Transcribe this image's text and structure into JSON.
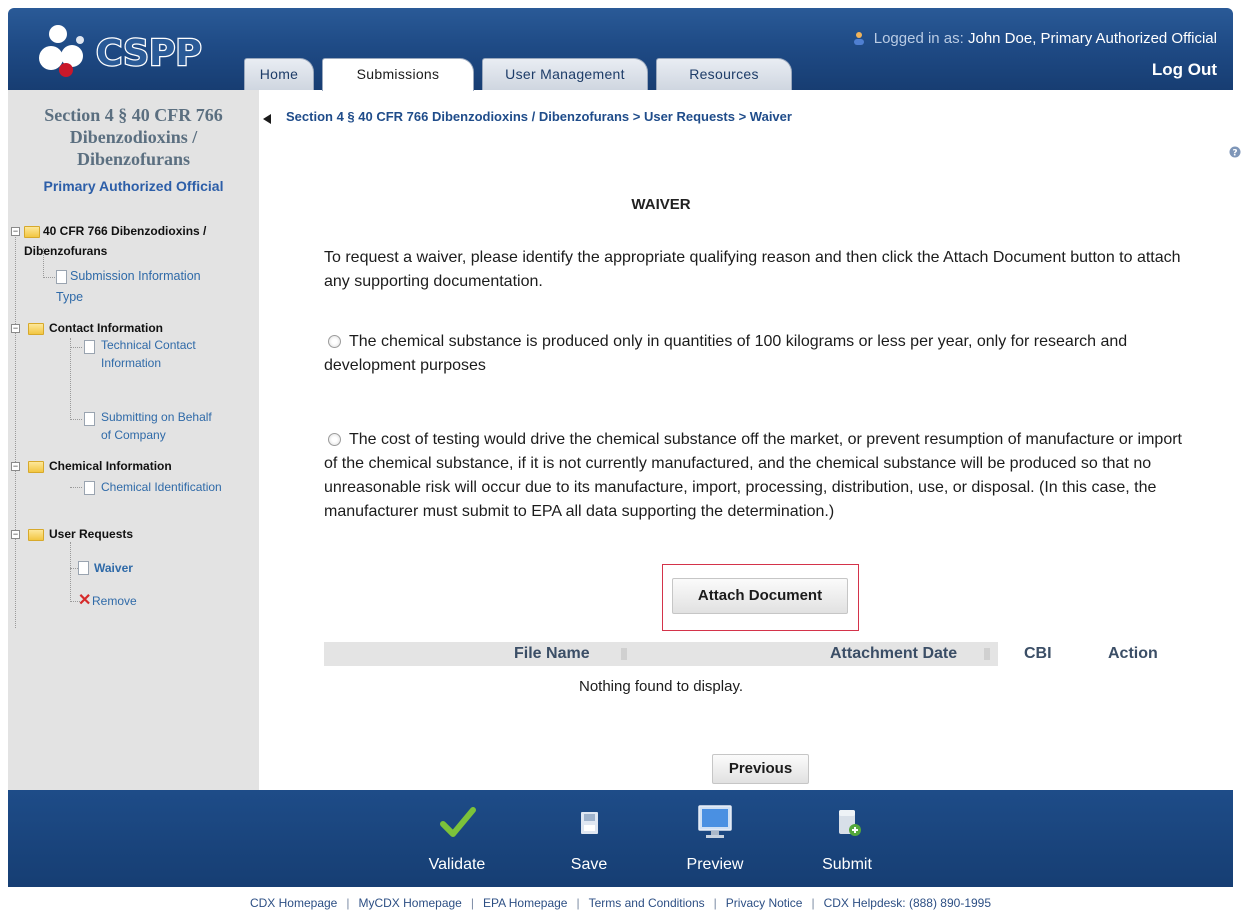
{
  "header": {
    "logo_text": "CSPP",
    "user_prefix": "Logged in as:",
    "user_name": "John Doe, Primary Authorized Official",
    "logout_label": "Log Out",
    "tabs": [
      {
        "label": "Home",
        "active": false
      },
      {
        "label": "Submissions",
        "active": true
      },
      {
        "label": "User Management",
        "active": false
      },
      {
        "label": "Resources",
        "active": false
      }
    ]
  },
  "sidebar": {
    "title_line1": "Section 4 § 40 CFR 766",
    "title_line2": "Dibenzodioxins /",
    "title_line3": "Dibenzofurans",
    "role": "Primary Authorized Official",
    "tree": {
      "root_line1": "40 CFR 766 Dibenzodioxins /",
      "root_line2": "Dibenzofurans",
      "submission_info_line1": "Submission Information",
      "submission_info_line2": "Type",
      "contact_info": "Contact Information",
      "technical_contact_line1": "Technical Contact",
      "technical_contact_line2": "Information",
      "behalf_line1": "Submitting on Behalf",
      "behalf_line2": "of Company",
      "chemical_info": "Chemical Information",
      "chemical_identification": "Chemical Identification",
      "user_requests": "User Requests",
      "waiver": "Waiver",
      "remove": "Remove"
    }
  },
  "main": {
    "breadcrumb": "Section 4 § 40 CFR 766 Dibenzodioxins / Dibenzofurans > User Requests > Waiver",
    "title": "WAIVER",
    "intro": "To request a waiver, please identify the appropriate qualifying reason and then click the Attach Document button to attach any supporting documentation.",
    "option1": "The chemical substance is produced only in quantities of 100 kilograms or less per year, only for research and development purposes",
    "option2": "The cost of testing would drive the chemical substance off the market, or prevent resumption of manufacture or import of the chemical substance, if it is not currently manufactured, and the chemical substance will be produced so that no unreasonable risk will occur due to its manufacture, import, processing, distribution, use, or disposal. (In this case, the manufacturer must submit to EPA all data supporting the determination.)",
    "attach_label": "Attach Document",
    "table": {
      "columns": [
        "File Name",
        "Attachment Date",
        "CBI",
        "Action"
      ],
      "empty_message": "Nothing found to display."
    },
    "previous_label": "Previous"
  },
  "toolbar": {
    "items": [
      {
        "label": "Validate",
        "icon": "checkmark-icon"
      },
      {
        "label": "Save",
        "icon": "save-icon"
      },
      {
        "label": "Preview",
        "icon": "monitor-icon"
      },
      {
        "label": "Submit",
        "icon": "submit-icon"
      }
    ]
  },
  "footer": {
    "links": [
      "CDX Homepage",
      "MyCDX Homepage",
      "EPA Homepage",
      "Terms and Conditions",
      "Privacy Notice",
      "CDX Helpdesk: (888) 890-1995"
    ]
  },
  "colors": {
    "header_blue": "#1f4b86",
    "sidebar_gray": "#e3e3e3",
    "link_blue": "#1f4c8a",
    "highlight_red": "#d4334a"
  }
}
